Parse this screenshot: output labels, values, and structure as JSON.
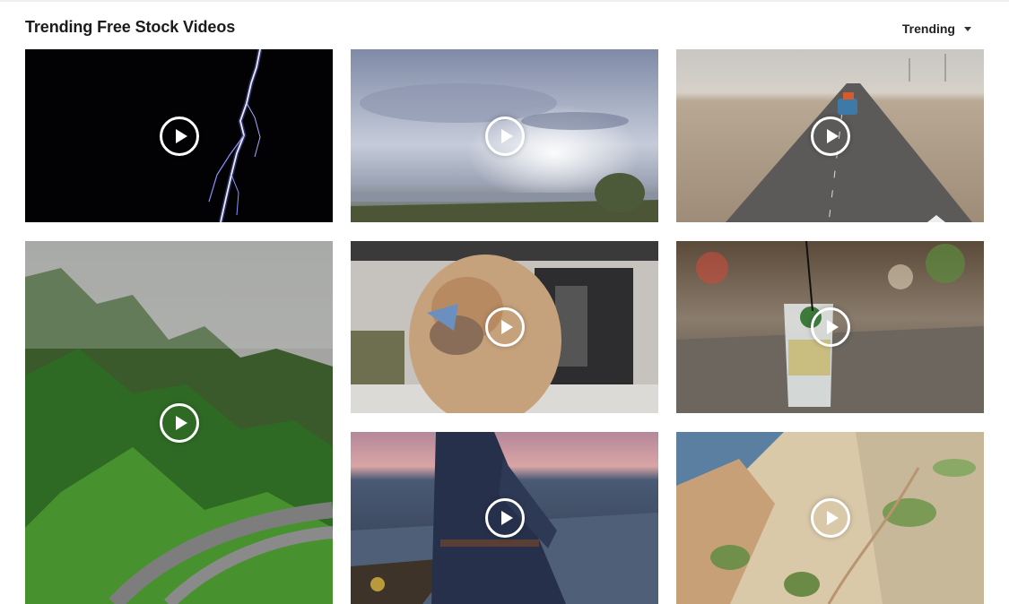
{
  "page": {
    "title": "Trending Free Stock Videos",
    "sort": {
      "label": "Trending",
      "icon": "caret-down-icon"
    }
  },
  "videos": [
    {
      "id": "lightning",
      "thumb": "lightning bolt on black sky",
      "icon": "play-icon"
    },
    {
      "id": "lake-sunset",
      "thumb": "cloudy sky over lake",
      "icon": "play-icon"
    },
    {
      "id": "desert-road",
      "thumb": "car driving on desert road",
      "icon": "play-icon"
    },
    {
      "id": "mountain-highway",
      "thumb": "misty green mountains with highway",
      "icon": "play-icon"
    },
    {
      "id": "woman-dog",
      "thumb": "woman hugging curly dog",
      "icon": "play-icon"
    },
    {
      "id": "cocktail",
      "thumb": "cocktail glass on wooden table",
      "icon": "play-icon"
    },
    {
      "id": "beach-woman",
      "thumb": "woman walking on beach at dusk",
      "icon": "play-icon"
    },
    {
      "id": "coast-aerial",
      "thumb": "aerial view of sandy coastline",
      "icon": "play-icon"
    }
  ],
  "colors": {
    "title": "#1b1b1b",
    "play": "#ffffff"
  }
}
